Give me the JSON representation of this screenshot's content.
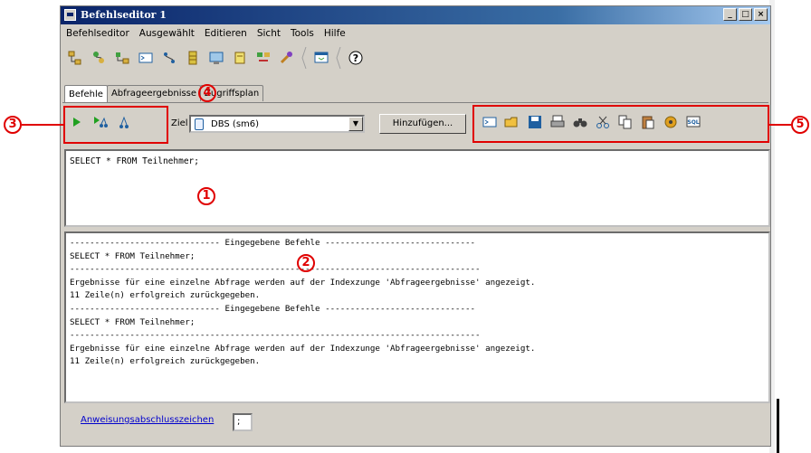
{
  "window": {
    "title": "Befehlseditor 1",
    "controls": [
      "_",
      "□",
      "×"
    ]
  },
  "menu": [
    "Befehlseditor",
    "Ausgewählt",
    "Editieren",
    "Sicht",
    "Tools",
    "Hilfe"
  ],
  "toolbar_icons": [
    "object-tree-icon",
    "replication-icon",
    "object-details-icon",
    "command-line-icon",
    "task-center-icon",
    "db-icon",
    "journal-icon",
    "license-icon",
    "visual-explain-icon",
    "tools-icon",
    "command-window-icon",
    "help-icon"
  ],
  "tabs": [
    {
      "label": "Befehle",
      "active": true
    },
    {
      "label": "Abfrageergebnisse",
      "active": false
    },
    {
      "label": "Zugriffsplan",
      "active": false
    }
  ],
  "command_bar": {
    "target_label": "Ziel",
    "target_value": "DBS (sm6)",
    "add_button": "Hinzufügen..."
  },
  "editor": {
    "text": "SELECT * FROM Teilnehmer;"
  },
  "output": {
    "lines": [
      "------------------------------ Eingegebene Befehle ------------------------------",
      "SELECT * FROM Teilnehmer;",
      "----------------------------------------------------------------------------------",
      "Ergebnisse für eine einzelne Abfrage werden auf der Indexzunge 'Abfrageergebnisse' angezeigt.",
      "11 Zeile(n) erfolgreich zurückgegeben.",
      "------------------------------ Eingegebene Befehle ------------------------------",
      "SELECT * FROM Teilnehmer;",
      "----------------------------------------------------------------------------------",
      "Ergebnisse für eine einzelne Abfrage werden auf der Indexzunge 'Abfrageergebnisse' angezeigt.",
      "11 Zeile(n) erfolgreich zurückgegeben."
    ]
  },
  "bottom": {
    "terminator_link": "Anweisungsabschlusszeichen",
    "terminator_value": ";"
  },
  "callouts": [
    "1",
    "2",
    "3",
    "4",
    "5"
  ],
  "colors": {
    "callout": "#e00000",
    "titlebar": "#0a246a",
    "link": "#0000cc"
  }
}
